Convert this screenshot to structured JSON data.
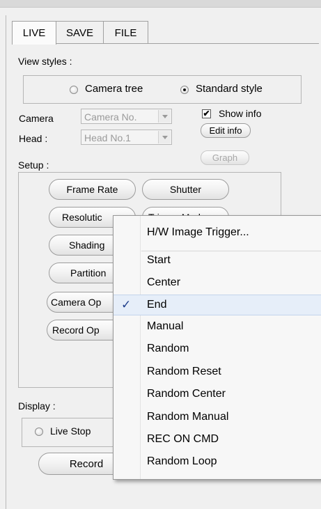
{
  "tabs": [
    "LIVE",
    "SAVE",
    "FILE"
  ],
  "view_styles": {
    "label": "View styles :",
    "options": [
      "Camera tree",
      "Standard style"
    ],
    "selected": "Standard style"
  },
  "camera": {
    "label": "Camera",
    "value": "Camera No."
  },
  "head": {
    "label": "Head :",
    "value": "Head No.1"
  },
  "show_info": {
    "label": "Show info",
    "checked": true,
    "check_glyph": "✔"
  },
  "edit_info_label": "Edit info",
  "graph_label": "Graph",
  "setup": {
    "label": "Setup :",
    "buttons": [
      "Frame Rate",
      "Shutter",
      "Resolution",
      "Trigger Mode",
      "Shading",
      "Partition",
      "Camera Option",
      "Record Option"
    ],
    "visible_text": [
      "Frame Rate",
      "Shutter",
      "Resolutic",
      "Trigger Mod",
      "Shading",
      "Partition",
      "Camera Op",
      "Record Op"
    ]
  },
  "display": {
    "label": "Display :",
    "live_stop_label": "Live Stop",
    "record_label": "Record"
  },
  "trigger_menu": {
    "items": [
      "H/W Image Trigger...",
      "Start",
      "Center",
      "End",
      "Manual",
      "Random",
      "Random Reset",
      "Random Center",
      "Random Manual",
      "REC ON CMD",
      "Random Loop"
    ],
    "checked_item": "End",
    "check_glyph": "✓"
  }
}
